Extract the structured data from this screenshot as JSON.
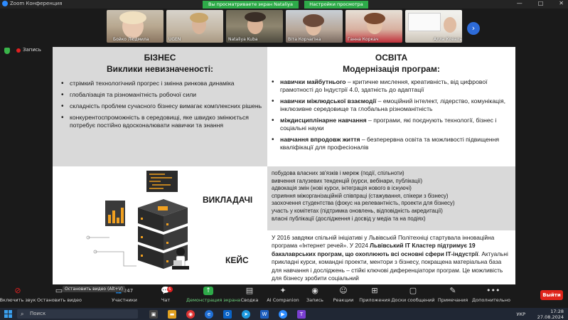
{
  "window": {
    "app_title": "Zoom Конференция",
    "share_banner": "Вы просматриваете экран Nataliya Kuba",
    "view_options": "Настройки просмотра",
    "controls": [
      "—",
      "□",
      "✕"
    ]
  },
  "participants": [
    {
      "name": "Бойко Людмила"
    },
    {
      "name": "UGEN"
    },
    {
      "name": "Nataliya Kuba"
    },
    {
      "name": "Віта Корчагіна"
    },
    {
      "name": "Ганна Коркач"
    },
    {
      "name": "Алла Коваль"
    }
  ],
  "recording": {
    "label": "Запись"
  },
  "slide": {
    "business": {
      "title": "БІЗНЕС",
      "subtitle": "Виклики невизначеності:",
      "bullets": [
        "стрімкий технологічний прогрес і змінна ринкова динаміка",
        "глобалізація та різноманітність робочої сили",
        "складність проблем сучасного бізнесу вимагає комплексних рішень",
        "конкурентоспроможність в середовищі, яке швидко змінюється потребує постійно вдосконалювати навички та знання"
      ]
    },
    "education": {
      "title": "ОСВІТА",
      "subtitle": "Модернізація програм:",
      "bullets": [
        {
          "bold": "навички майбутнього",
          "text": " – критичне мислення, креативність, від цифрової грамотності до Індустрії 4.0, здатність до адаптації"
        },
        {
          "bold": "навички міжлюдської взаємодії",
          "text": " – емоційний інтелект, лідерство, комунікація, інклюзивне середовище та глобальна різноманітність"
        },
        {
          "bold": "міждисциплінарне навчання",
          "text": " – програми, які поєднують технології, бізнес і соціальні науки"
        },
        {
          "bold": "навчання впродовж життя",
          "text": " – безперервна освіта та можливості підвищення кваліфікації для професіоналів"
        }
      ]
    },
    "teachers": {
      "label": "ВИКЛАДАЧІ",
      "items": [
        "побудова власних зв'язків і мереж (події, спільноти)",
        "вивчення галузевих тенденцій (курси, вебінари, публікації)",
        "адвокація змін (нові курси, інтеграція нового в існуючі)",
        "сприяння міжорганізаційній співпраці (стажування, спікери з бізнесу)",
        "заохочення студентства (фокус на релевантність, проекти для бізнесу)",
        "участь у комітетах (підтримка оновлень, відповідність акредитації)",
        "власні публікації (дослідження і досвід у медіа та на подіях)"
      ]
    },
    "case": {
      "label": "КЕЙС",
      "text_1": "У 2016 завдяки спільній ініціативі у Львівській Політехніці стартувала інноваційна програма «Інтернет речей». У 2024 ",
      "text_bold": "Львівський ІТ Кластер підтримує 19 бакалаврських програм, що охоплюють всі основні сфери ІТ-індустрії",
      "text_2": ". Актуальні прикладні курси, командні проекти, ментори з бізнесу, покращена матеріальна база для навчання і досліджень – стійкі ключові диференціатори програм. Це можливість для бізнесу зробити соціальний"
    }
  },
  "toolbar": {
    "tooltip": "Остановить видео (Alt+V)",
    "buttons": [
      {
        "label": "Включить звук",
        "icon": "mic-muted-icon"
      },
      {
        "label": "Остановить видео",
        "icon": "video-icon"
      },
      {
        "label": "Участники",
        "icon": "participants-icon",
        "count": "247"
      },
      {
        "label": "Чат",
        "icon": "chat-icon",
        "badge": "5"
      },
      {
        "label": "Демонстрация экрана",
        "icon": "share-screen-icon"
      },
      {
        "label": "Сводка",
        "icon": "summary-icon"
      },
      {
        "label": "AI Companion",
        "icon": "ai-companion-icon"
      },
      {
        "label": "Запись",
        "icon": "record-icon"
      },
      {
        "label": "Реакции",
        "icon": "reactions-icon"
      },
      {
        "label": "Приложения",
        "icon": "apps-icon"
      },
      {
        "label": "Доски сообщений",
        "icon": "whiteboard-icon"
      },
      {
        "label": "Примечания",
        "icon": "notes-icon"
      },
      {
        "label": "Дополнительно",
        "icon": "more-icon"
      }
    ],
    "leave": "Выйти"
  },
  "taskbar": {
    "search_placeholder": "Поиск",
    "lang": "УКР",
    "time": "17:28",
    "date": "27.08.2024"
  },
  "colors": {
    "share_green": "#2eab49",
    "leave_red": "#e0241a",
    "slide_grey": "#d9d9d9",
    "accent_blue": "#2d6bd8"
  }
}
